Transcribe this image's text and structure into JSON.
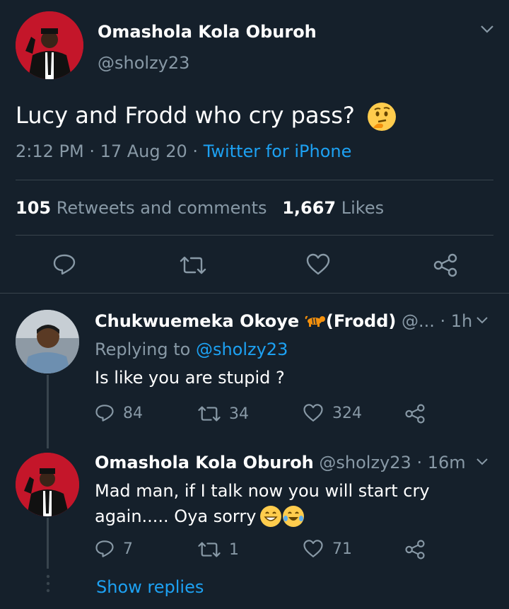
{
  "main_tweet": {
    "display_name": "Omashola Kola Oburoh",
    "handle": "@sholzy23",
    "text": "Lucy and Frodd who cry pass?",
    "emoji": "thinking-face",
    "timestamp": "2:12 PM · 17 Aug 20 · ",
    "source": "Twitter for iPhone",
    "retweets_count": "105",
    "retweets_label": "Retweets and comments",
    "likes_count": "1,667",
    "likes_label": "Likes"
  },
  "replies": [
    {
      "display_name": "Chukwuemeka Okoye",
      "name_suffix": "(Frodd)",
      "handle_truncated": "@...",
      "time": "· 1h",
      "replying_prefix": "Replying to ",
      "replying_handle": "@sholzy23",
      "text": "Is like you are stupid ?",
      "reply_count": "84",
      "retweet_count": "34",
      "like_count": "324"
    },
    {
      "display_name": "Omashola Kola Oburoh",
      "handle": "@sholzy23",
      "time": "· 16m",
      "text_line1": "Mad man, if I talk now you will start cry",
      "text_line2": "again..... Oya sorry",
      "reply_count": "7",
      "retweet_count": "1",
      "like_count": "71"
    }
  ],
  "show_replies": "Show replies",
  "colors": {
    "background": "#15202b",
    "accent": "#1da1f2",
    "muted": "#8899a6",
    "divider": "#38444d"
  }
}
